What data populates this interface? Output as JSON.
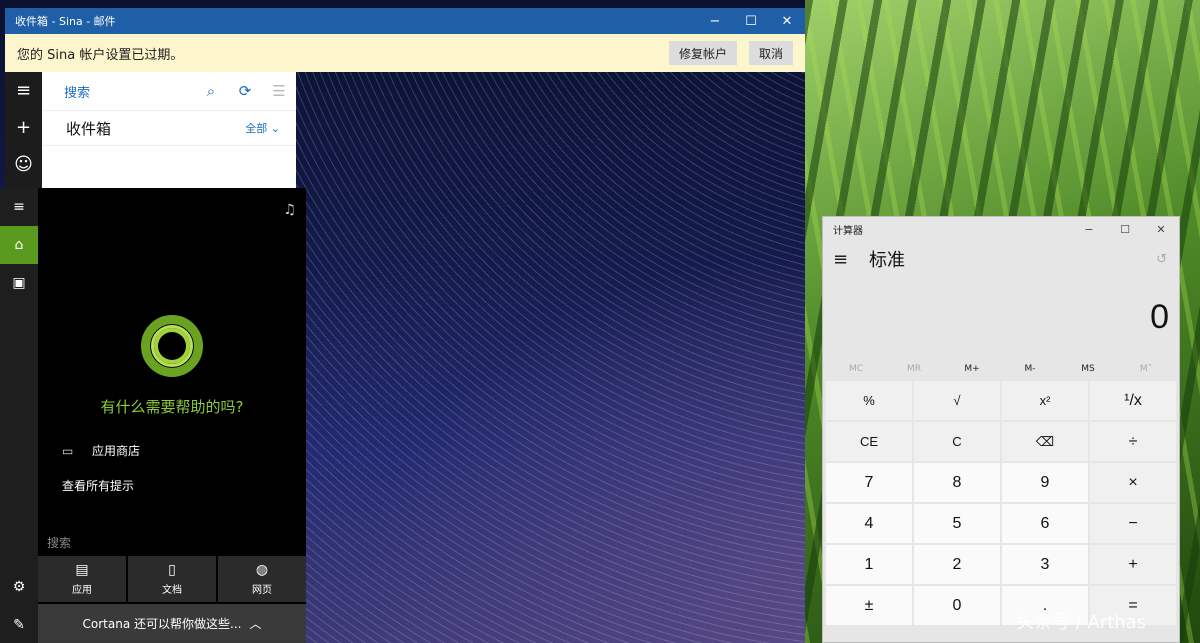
{
  "mail": {
    "title": "收件箱 - Sina - 邮件",
    "banner_message": "您的 Sina 帐户设置已过期。",
    "fix_button": "修复帐户",
    "cancel_button": "取消",
    "search_label": "搜索",
    "folder_title": "收件箱",
    "filter_label": "全部"
  },
  "cortana": {
    "question": "有什么需要帮助的吗?",
    "items": [
      "应用商店",
      "查看所有提示"
    ],
    "search_label": "搜索",
    "scopes": [
      "应用",
      "文档",
      "网页"
    ],
    "bar_text": "Cortana 还可以帮你做这些..."
  },
  "calc": {
    "title": "计算器",
    "mode": "标准",
    "display": "0",
    "memory": [
      {
        "label": "MC",
        "enabled": false
      },
      {
        "label": "MR",
        "enabled": false
      },
      {
        "label": "M+",
        "enabled": true
      },
      {
        "label": "M-",
        "enabled": true
      },
      {
        "label": "MS",
        "enabled": true
      },
      {
        "label": "M˅",
        "enabled": false
      }
    ],
    "keys": [
      "%",
      "√",
      "x²",
      "¹/x",
      "CE",
      "C",
      "⌫",
      "÷",
      "7",
      "8",
      "9",
      "×",
      "4",
      "5",
      "6",
      "−",
      "1",
      "2",
      "3",
      "+",
      "±",
      "0",
      ".",
      "="
    ]
  },
  "watermark": "头条号 / Arthas",
  "colors": {
    "mail_titlebar": "#1f5fa8",
    "banner": "#fdf5cc",
    "cortana_accent": "#8ecb3a",
    "cortana_home_active": "#5a9a1e"
  }
}
